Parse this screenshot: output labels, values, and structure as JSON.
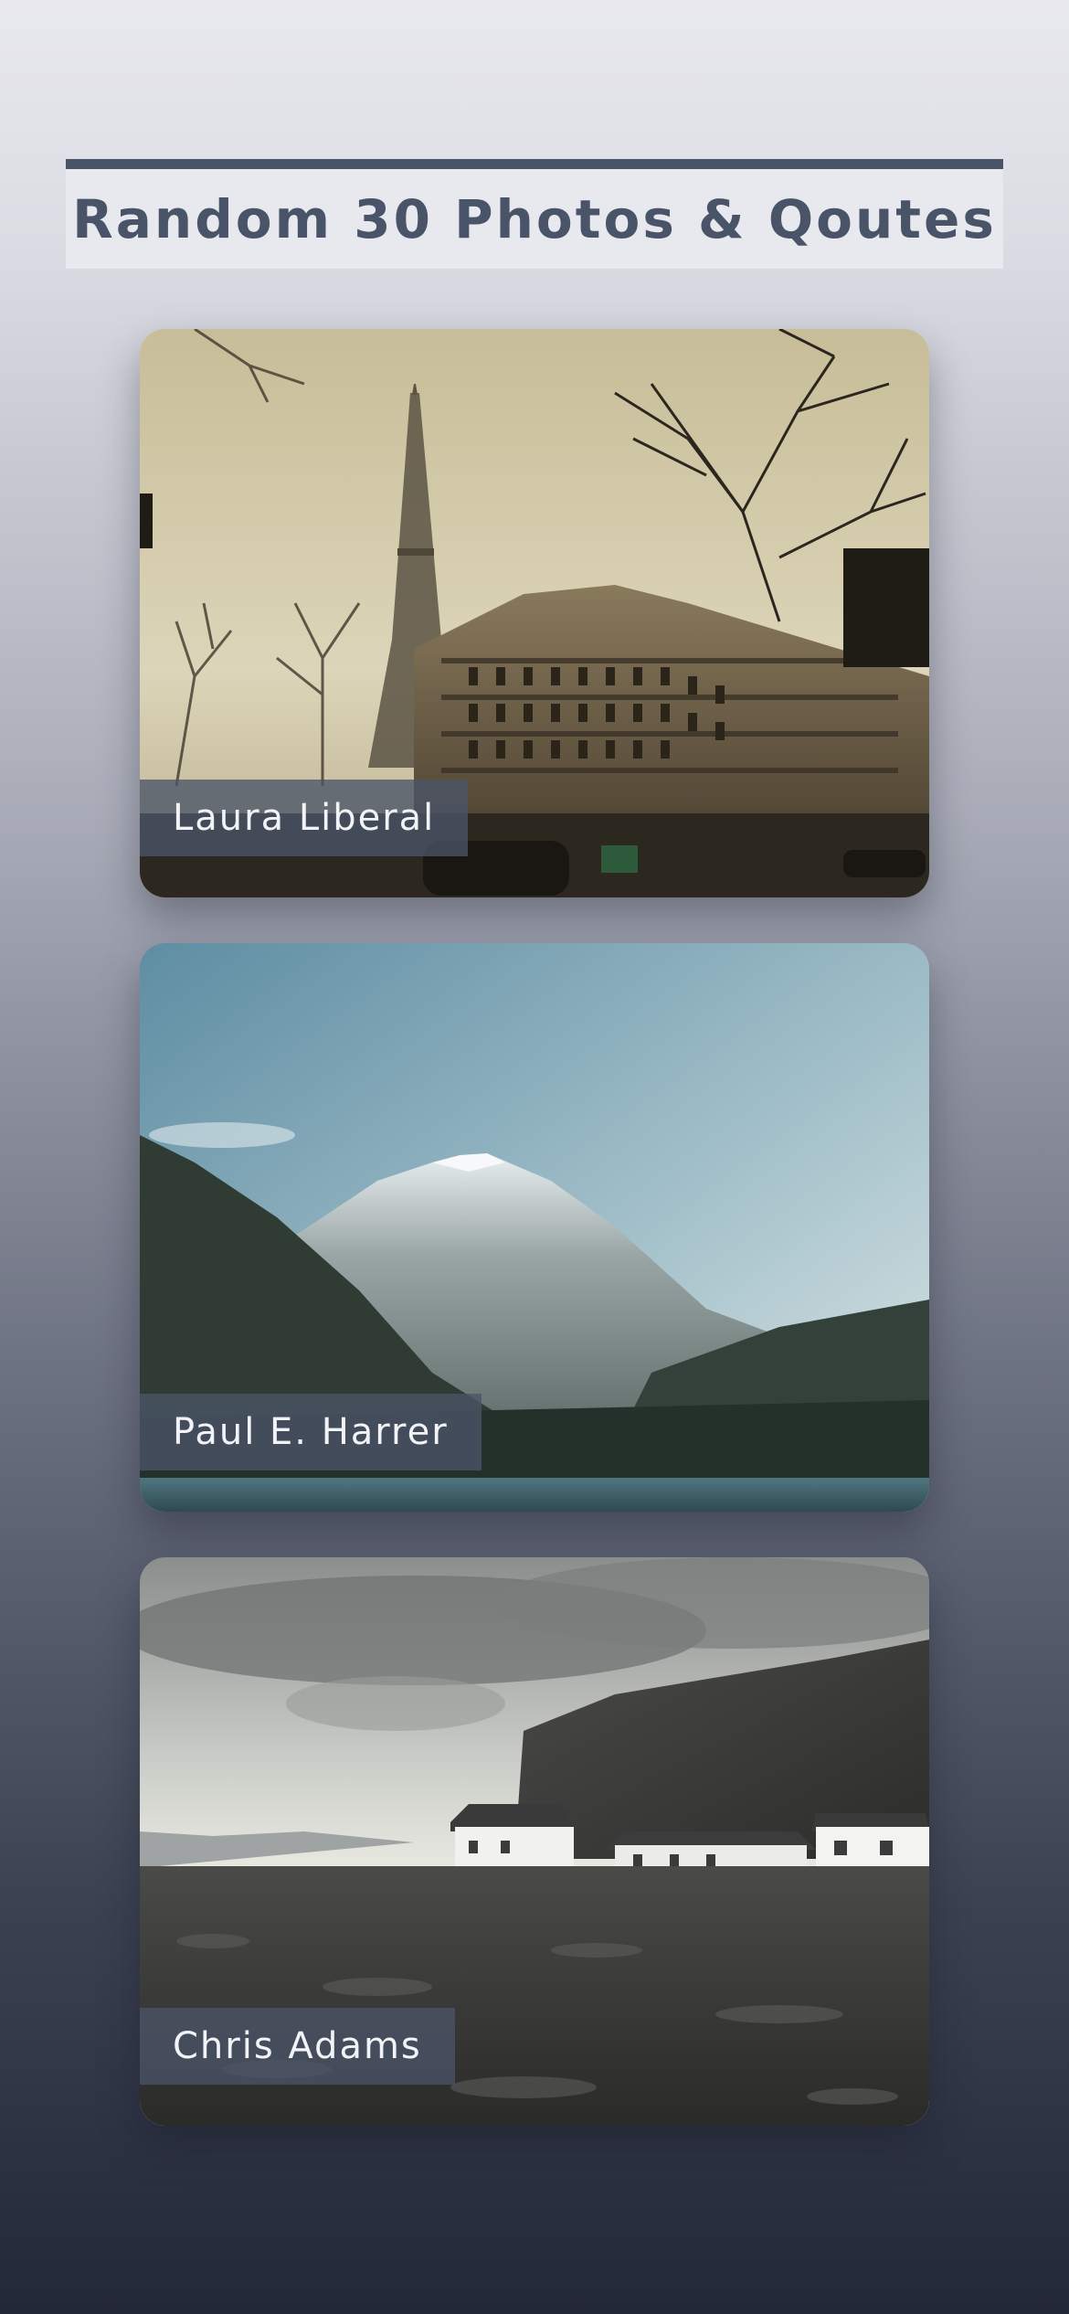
{
  "page": {
    "title": "Random 30 Photos & Qoutes"
  },
  "cards": [
    {
      "author": "Laura Liberal",
      "scene": "eiffel-tower-street"
    },
    {
      "author": "Paul E. Harrer",
      "scene": "snowy-mountain-lake"
    },
    {
      "author": "Chris Adams",
      "scene": "cottages-by-cliff"
    }
  ],
  "colors": {
    "accent": "#4a5468",
    "header_bg": "#e8e9ee",
    "caption_text": "#f2f3f6"
  }
}
